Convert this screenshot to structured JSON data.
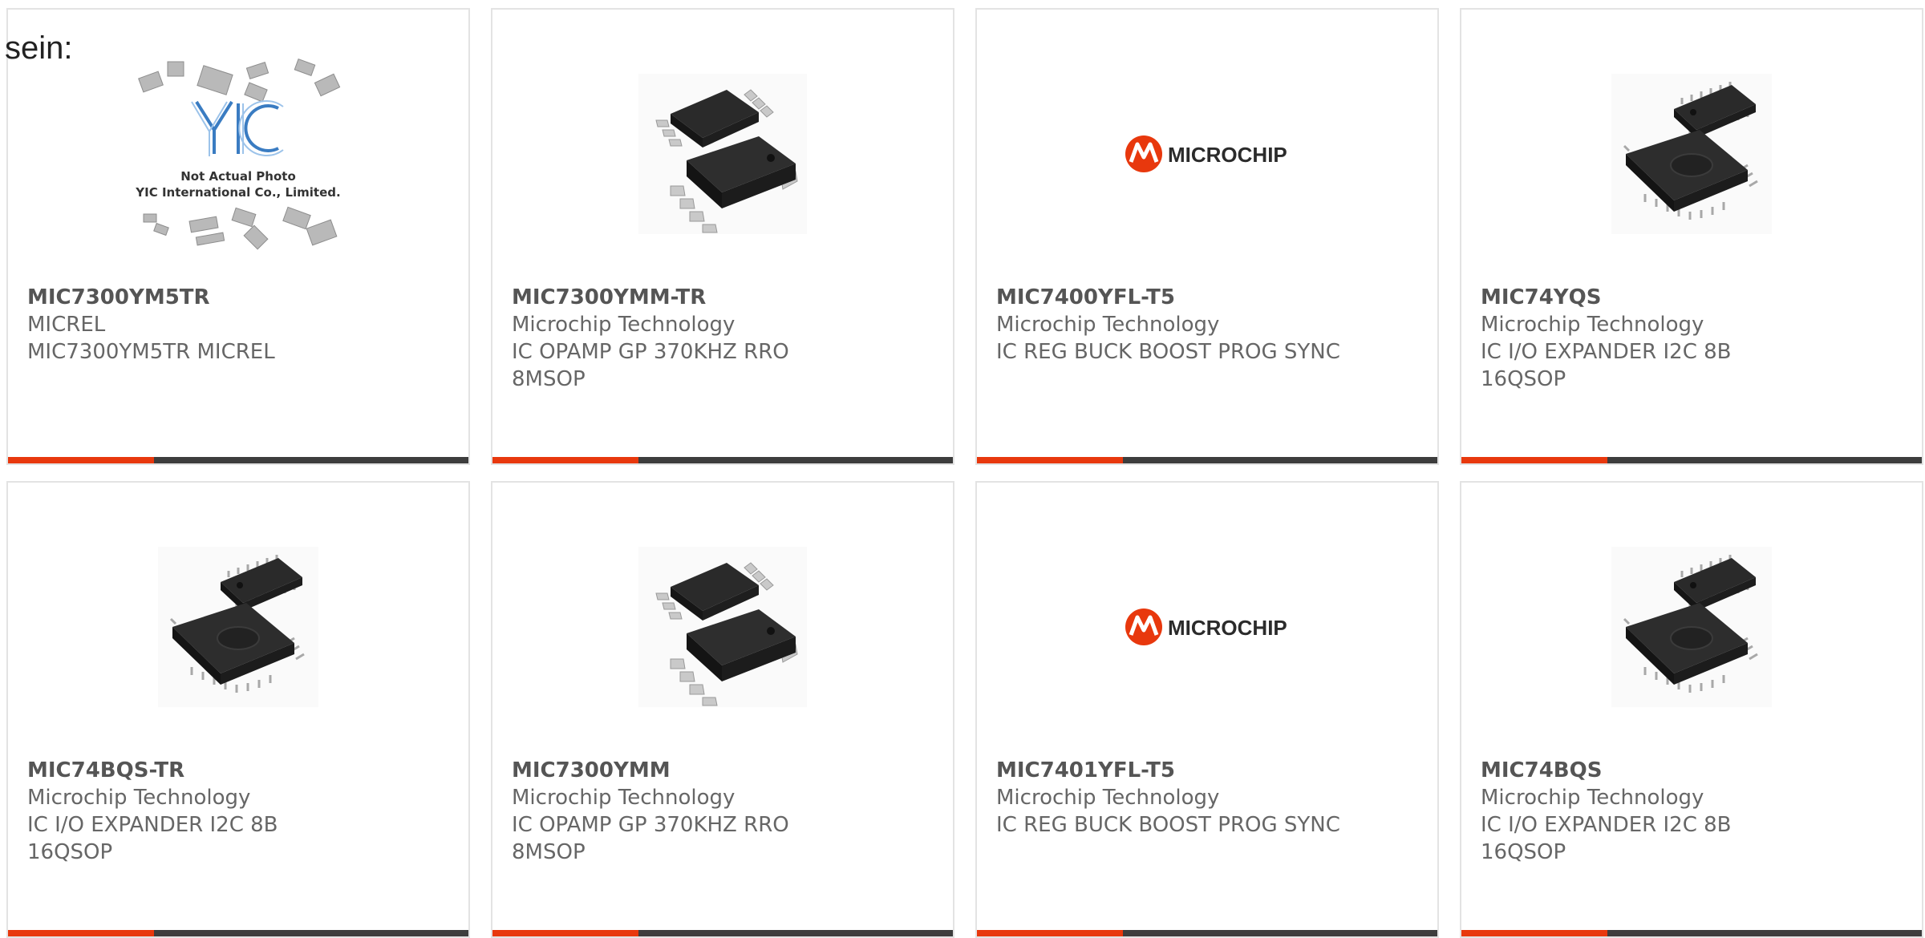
{
  "intro_text": "sein:",
  "accent_color": "#e8380d",
  "bar_color": "#3d3d3d",
  "placeholder": {
    "line1": "Not Actual Photo",
    "line2": "YIC International Co., Limited.",
    "logo_text": "YIC"
  },
  "brand_logo_text": "MICROCHIP",
  "products": [
    {
      "pn": "MIC7300YM5TR",
      "mfr": "MICREL",
      "desc": "MIC7300YM5TR MICREL",
      "image": "placeholder-photo"
    },
    {
      "pn": "MIC7300YMM-TR",
      "mfr": "Microchip Technology",
      "desc": "IC OPAMP GP 370KHZ RRO\n8MSOP",
      "image": "msop8-chip"
    },
    {
      "pn": "MIC7400YFL-T5",
      "mfr": "Microchip Technology",
      "desc": "IC REG BUCK BOOST PROG SYNC",
      "image": "microchip-logo"
    },
    {
      "pn": "MIC74YQS",
      "mfr": "Microchip Technology",
      "desc": "IC I/O EXPANDER I2C 8B\n16QSOP",
      "image": "qsop16-chip"
    },
    {
      "pn": "MIC74BQS-TR",
      "mfr": "Microchip Technology",
      "desc": "IC I/O EXPANDER I2C 8B\n16QSOP",
      "image": "qsop16-chip"
    },
    {
      "pn": "MIC7300YMM",
      "mfr": "Microchip Technology",
      "desc": "IC OPAMP GP 370KHZ RRO\n8MSOP",
      "image": "msop8-chip"
    },
    {
      "pn": "MIC7401YFL-T5",
      "mfr": "Microchip Technology",
      "desc": "IC REG BUCK BOOST PROG SYNC",
      "image": "microchip-logo"
    },
    {
      "pn": "MIC74BQS",
      "mfr": "Microchip Technology",
      "desc": "IC I/O EXPANDER I2C 8B\n16QSOP",
      "image": "qsop16-chip"
    }
  ]
}
